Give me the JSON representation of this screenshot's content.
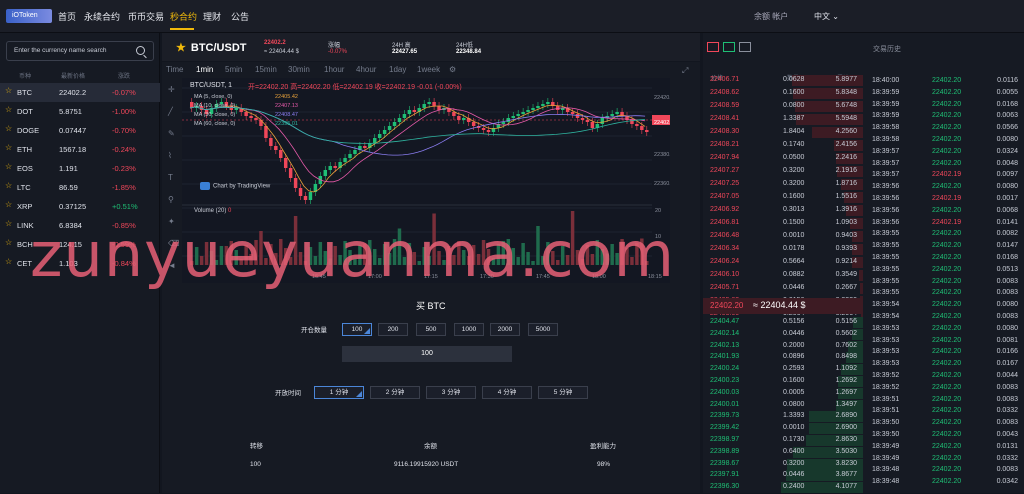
{
  "nav": {
    "logo": "iOToken",
    "items": [
      "首页",
      "永续合约",
      "币币交易",
      "秒合约",
      "理财",
      "公告"
    ],
    "active": 3,
    "account": "余额 帐户",
    "lang": "中文"
  },
  "search": {
    "placeholder": "Enter the currency name search"
  },
  "coinlist": {
    "headers": [
      "币种",
      "最新价格",
      "涨跌"
    ],
    "rows": [
      {
        "name": "BTC",
        "price": "22402.2",
        "change": "-0.07%",
        "dir": "down",
        "sel": true
      },
      {
        "name": "DOT",
        "price": "5.8751",
        "change": "-1.00%",
        "dir": "down"
      },
      {
        "name": "DOGE",
        "price": "0.07447",
        "change": "-0.70%",
        "dir": "down"
      },
      {
        "name": "ETH",
        "price": "1567.18",
        "change": "-0.24%",
        "dir": "down"
      },
      {
        "name": "EOS",
        "price": "1.191",
        "change": "-0.23%",
        "dir": "down"
      },
      {
        "name": "LTC",
        "price": "86.59",
        "change": "-1.85%",
        "dir": "down"
      },
      {
        "name": "XRP",
        "price": "0.37125",
        "change": "+0.51%",
        "dir": "up"
      },
      {
        "name": "LINK",
        "price": "6.8384",
        "change": "-0.85%",
        "dir": "down"
      },
      {
        "name": "BCH",
        "price": "124.15",
        "change": "-0.59%",
        "dir": "down"
      },
      {
        "name": "CET",
        "price": "1.103",
        "change": "-0.84%",
        "dir": "down"
      }
    ]
  },
  "header": {
    "pair": "BTC/USDT",
    "price": "22402.2",
    "price_sub": "≈ 22404.44 $",
    "change_label": "涨幅",
    "change": "-0.07%",
    "high_label": "24H 高",
    "high": "22427.65",
    "low_label": "24H低",
    "low": "22348.84"
  },
  "timeframes": [
    "Time",
    "1min",
    "5min",
    "15min",
    "30min",
    "1hour",
    "4hour",
    "1day",
    "1week"
  ],
  "tf_active": 1,
  "chart_info": {
    "symbol": "BTC/USDT, 1",
    "ohlc": "开=22402.20  高=22402.20  低=22402.19  收=22402.19  -0.01 (-0.00%)",
    "ma": [
      "MA (5, close, 0)",
      "MA (10, close, 0)",
      "MA (30, close, 0)",
      "MA (60, close, 0)"
    ],
    "ma_vals": [
      "22405.42",
      "22407.13",
      "22408.47",
      "22395.01"
    ],
    "ma_colors": [
      "#e9a23b",
      "#e55aa9",
      "#8a7df0",
      "#2fb4a0"
    ],
    "brand": "Chart by TradingView",
    "volume": "Volume (20)",
    "volume_val": "0",
    "price_ticks": [
      "22420.00",
      "22402.19",
      "22380.00",
      "22360.00"
    ],
    "vol_ticks": [
      "20",
      "10"
    ],
    "time_ticks": [
      "16:45",
      "17:00",
      "17:15",
      "17:30",
      "17:45",
      "18:00",
      "18:15",
      "18:30"
    ],
    "last_label": "22402.19"
  },
  "form": {
    "title": "买 BTC",
    "amount_label": "开仓数量",
    "amounts": [
      "100",
      "200",
      "500",
      "1000",
      "2000",
      "5000"
    ],
    "amount_value": "100",
    "time_label": "开放时间",
    "times": [
      "1 分钟",
      "2 分钟",
      "3 分钟",
      "4 分钟",
      "5 分钟"
    ],
    "sum_headers": [
      "转移",
      "余额",
      "盈利能力"
    ],
    "sum_values": [
      "100",
      "9116.19915920 USDT",
      "98%"
    ]
  },
  "book": {
    "headers": [
      "价格",
      "数量",
      "累计"
    ],
    "asks": [
      [
        "22406.71",
        "0.0628",
        "5.8977"
      ],
      [
        "22408.62",
        "0.1600",
        "5.8348"
      ],
      [
        "22408.59",
        "0.0800",
        "5.6748"
      ],
      [
        "22408.41",
        "1.3387",
        "5.5948"
      ],
      [
        "22408.30",
        "1.8404",
        "4.2560"
      ],
      [
        "22408.21",
        "0.1740",
        "2.4156"
      ],
      [
        "22407.94",
        "0.0500",
        "2.2416"
      ],
      [
        "22407.27",
        "0.3200",
        "2.1916"
      ],
      [
        "22407.25",
        "0.3200",
        "1.8716"
      ],
      [
        "22407.05",
        "0.1600",
        "1.5516"
      ],
      [
        "22406.92",
        "0.3013",
        "1.3916"
      ],
      [
        "22406.81",
        "0.1500",
        "1.0903"
      ],
      [
        "22406.48",
        "0.0010",
        "0.9403"
      ],
      [
        "22406.34",
        "0.0178",
        "0.9393"
      ],
      [
        "22406.24",
        "0.5664",
        "0.9214"
      ],
      [
        "22406.10",
        "0.0882",
        "0.3549"
      ],
      [
        "22405.71",
        "0.0446",
        "0.2667"
      ],
      [
        "22405.63",
        "0.0156",
        "0.2220"
      ],
      [
        "22405.60",
        "0.2064",
        "0.2064"
      ]
    ],
    "mid_price": "22402.20",
    "mid_usd": "≈ 22404.44 $",
    "bids": [
      [
        "22404.47",
        "0.5156",
        "0.5156"
      ],
      [
        "22402.14",
        "0.0446",
        "0.5602"
      ],
      [
        "22402.13",
        "0.2000",
        "0.7602"
      ],
      [
        "22401.93",
        "0.0896",
        "0.8498"
      ],
      [
        "22400.24",
        "0.2593",
        "1.1092"
      ],
      [
        "22400.23",
        "0.1600",
        "1.2692"
      ],
      [
        "22400.03",
        "0.0005",
        "1.2697"
      ],
      [
        "22400.01",
        "0.0800",
        "1.3497"
      ],
      [
        "22399.73",
        "1.3393",
        "2.6890"
      ],
      [
        "22399.42",
        "0.0010",
        "2.6900"
      ],
      [
        "22398.97",
        "0.1730",
        "2.8630"
      ],
      [
        "22398.89",
        "0.6400",
        "3.5030"
      ],
      [
        "22398.67",
        "0.3200",
        "3.8230"
      ],
      [
        "22397.91",
        "0.0446",
        "3.8677"
      ],
      [
        "22396.30",
        "0.2400",
        "4.1077"
      ]
    ]
  },
  "trades": {
    "title": "交易历史",
    "rows": [
      [
        "18:40:00",
        "22402.20",
        "0.0116",
        "g"
      ],
      [
        "18:39:59",
        "22402.20",
        "0.0055",
        "g"
      ],
      [
        "18:39:59",
        "22402.20",
        "0.0168",
        "g"
      ],
      [
        "18:39:59",
        "22402.20",
        "0.0063",
        "g"
      ],
      [
        "18:39:58",
        "22402.20",
        "0.0566",
        "g"
      ],
      [
        "18:39:58",
        "22402.20",
        "0.0080",
        "g"
      ],
      [
        "18:39:57",
        "22402.20",
        "0.0324",
        "g"
      ],
      [
        "18:39:57",
        "22402.20",
        "0.0048",
        "g"
      ],
      [
        "18:39:57",
        "22402.19",
        "0.0097",
        "r"
      ],
      [
        "18:39:56",
        "22402.20",
        "0.0080",
        "g"
      ],
      [
        "18:39:56",
        "22402.19",
        "0.0017",
        "r"
      ],
      [
        "18:39:56",
        "22402.20",
        "0.0068",
        "g"
      ],
      [
        "18:39:56",
        "22402.19",
        "0.0141",
        "r"
      ],
      [
        "18:39:55",
        "22402.20",
        "0.0082",
        "g"
      ],
      [
        "18:39:55",
        "22402.20",
        "0.0147",
        "g"
      ],
      [
        "18:39:55",
        "22402.20",
        "0.0168",
        "g"
      ],
      [
        "18:39:55",
        "22402.20",
        "0.0513",
        "g"
      ],
      [
        "18:39:55",
        "22402.20",
        "0.0083",
        "g"
      ],
      [
        "18:39:55",
        "22402.20",
        "0.0083",
        "g"
      ],
      [
        "18:39:54",
        "22402.20",
        "0.0080",
        "g"
      ],
      [
        "18:39:54",
        "22402.20",
        "0.0083",
        "g"
      ],
      [
        "18:39:53",
        "22402.20",
        "0.0080",
        "g"
      ],
      [
        "18:39:53",
        "22402.20",
        "0.0081",
        "g"
      ],
      [
        "18:39:53",
        "22402.20",
        "0.0166",
        "g"
      ],
      [
        "18:39:53",
        "22402.20",
        "0.0167",
        "g"
      ],
      [
        "18:39:52",
        "22402.20",
        "0.0044",
        "g"
      ],
      [
        "18:39:52",
        "22402.20",
        "0.0083",
        "g"
      ],
      [
        "18:39:51",
        "22402.20",
        "0.0083",
        "g"
      ],
      [
        "18:39:51",
        "22402.20",
        "0.0332",
        "g"
      ],
      [
        "18:39:50",
        "22402.20",
        "0.0083",
        "g"
      ],
      [
        "18:39:50",
        "22402.20",
        "0.0043",
        "g"
      ],
      [
        "18:39:49",
        "22402.20",
        "0.0131",
        "g"
      ],
      [
        "18:39:49",
        "22402.20",
        "0.0332",
        "g"
      ],
      [
        "18:39:48",
        "22402.20",
        "0.0083",
        "g"
      ],
      [
        "18:39:48",
        "22402.20",
        "0.0342",
        "g"
      ]
    ]
  },
  "watermark": "zunyueyuanma.com",
  "colors": {
    "up": "#1fbf75",
    "down": "#f0475a",
    "accent": "#f0b90b",
    "select": "#4b86d8"
  }
}
